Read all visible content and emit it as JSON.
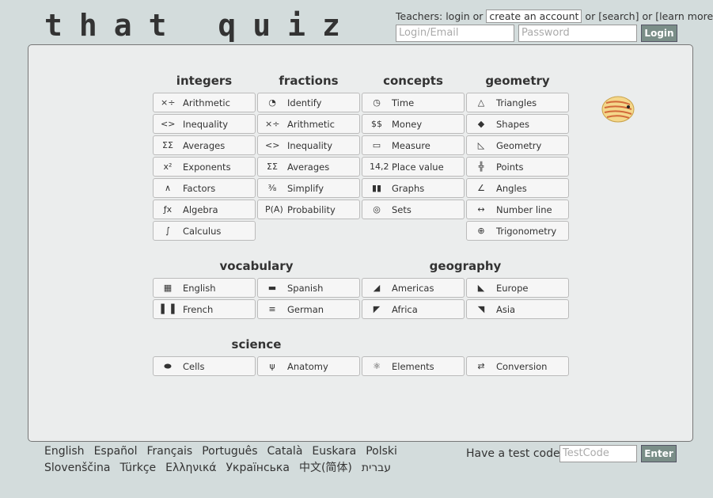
{
  "logo": "that quiz",
  "teachers": {
    "prefix": "Teachers:",
    "login": "login",
    "or1": "or",
    "create": "create an account",
    "or2": "or",
    "search": "[search]",
    "or3": "or",
    "learn": "[learn more]"
  },
  "login_form": {
    "email_placeholder": "Login/Email",
    "password_placeholder": "Password",
    "button": "Login"
  },
  "columns": [
    {
      "heading": "integers",
      "items": [
        {
          "icon": "×÷",
          "label": "Arithmetic"
        },
        {
          "icon": "<>",
          "label": "Inequality"
        },
        {
          "icon": "ΣΣ",
          "label": "Averages"
        },
        {
          "icon": "x²",
          "label": "Exponents"
        },
        {
          "icon": "∧",
          "label": "Factors"
        },
        {
          "icon": "ƒx",
          "label": "Algebra"
        },
        {
          "icon": "∫",
          "label": "Calculus"
        }
      ]
    },
    {
      "heading": "fractions",
      "items": [
        {
          "icon": "◔",
          "label": "Identify"
        },
        {
          "icon": "×÷",
          "label": "Arithmetic"
        },
        {
          "icon": "<>",
          "label": "Inequality"
        },
        {
          "icon": "ΣΣ",
          "label": "Averages"
        },
        {
          "icon": "⅜",
          "label": "Simplify"
        },
        {
          "icon": "P(A)",
          "label": "Probability"
        }
      ]
    },
    {
      "heading": "concepts",
      "items": [
        {
          "icon": "◷",
          "label": "Time"
        },
        {
          "icon": "$$",
          "label": "Money"
        },
        {
          "icon": "▭",
          "label": "Measure"
        },
        {
          "icon": "14,2",
          "label": "Place value"
        },
        {
          "icon": "▮▮",
          "label": "Graphs"
        },
        {
          "icon": "◎",
          "label": "Sets"
        }
      ]
    },
    {
      "heading": "geometry",
      "items": [
        {
          "icon": "△",
          "label": "Triangles"
        },
        {
          "icon": "◆",
          "label": "Shapes"
        },
        {
          "icon": "◺",
          "label": "Geometry"
        },
        {
          "icon": "╬",
          "label": "Points"
        },
        {
          "icon": "∠",
          "label": "Angles"
        },
        {
          "icon": "↔",
          "label": "Number line"
        },
        {
          "icon": "⊕",
          "label": "Trigonometry"
        }
      ]
    }
  ],
  "vocabulary": {
    "heading": "vocabulary",
    "items": [
      {
        "icon": "▦",
        "label": "English"
      },
      {
        "icon": "▬",
        "label": "Spanish"
      },
      {
        "icon": "▌▐",
        "label": "French"
      },
      {
        "icon": "≡",
        "label": "German"
      }
    ]
  },
  "geography": {
    "heading": "geography",
    "items": [
      {
        "icon": "◢",
        "label": "Americas"
      },
      {
        "icon": "◣",
        "label": "Europe"
      },
      {
        "icon": "◤",
        "label": "Africa"
      },
      {
        "icon": "◥",
        "label": "Asia"
      }
    ]
  },
  "science": {
    "heading": "science",
    "items": [
      {
        "icon": "⬬",
        "label": "Cells"
      },
      {
        "icon": "ψ",
        "label": "Anatomy"
      },
      {
        "icon": "⚛",
        "label": "Elements"
      },
      {
        "icon": "⇄",
        "label": "Conversion"
      }
    ]
  },
  "languages_row1": [
    "English",
    "Español",
    "Français",
    "Português",
    "Català",
    "Euskara",
    "Polski"
  ],
  "languages_row2": [
    "Slovenščina",
    "Türkçe",
    "Ελληνικά",
    "Українська",
    "中文(简体)",
    "עברית"
  ],
  "test": {
    "label": "Have a test code?",
    "placeholder": "TestCode",
    "button": "Enter"
  }
}
